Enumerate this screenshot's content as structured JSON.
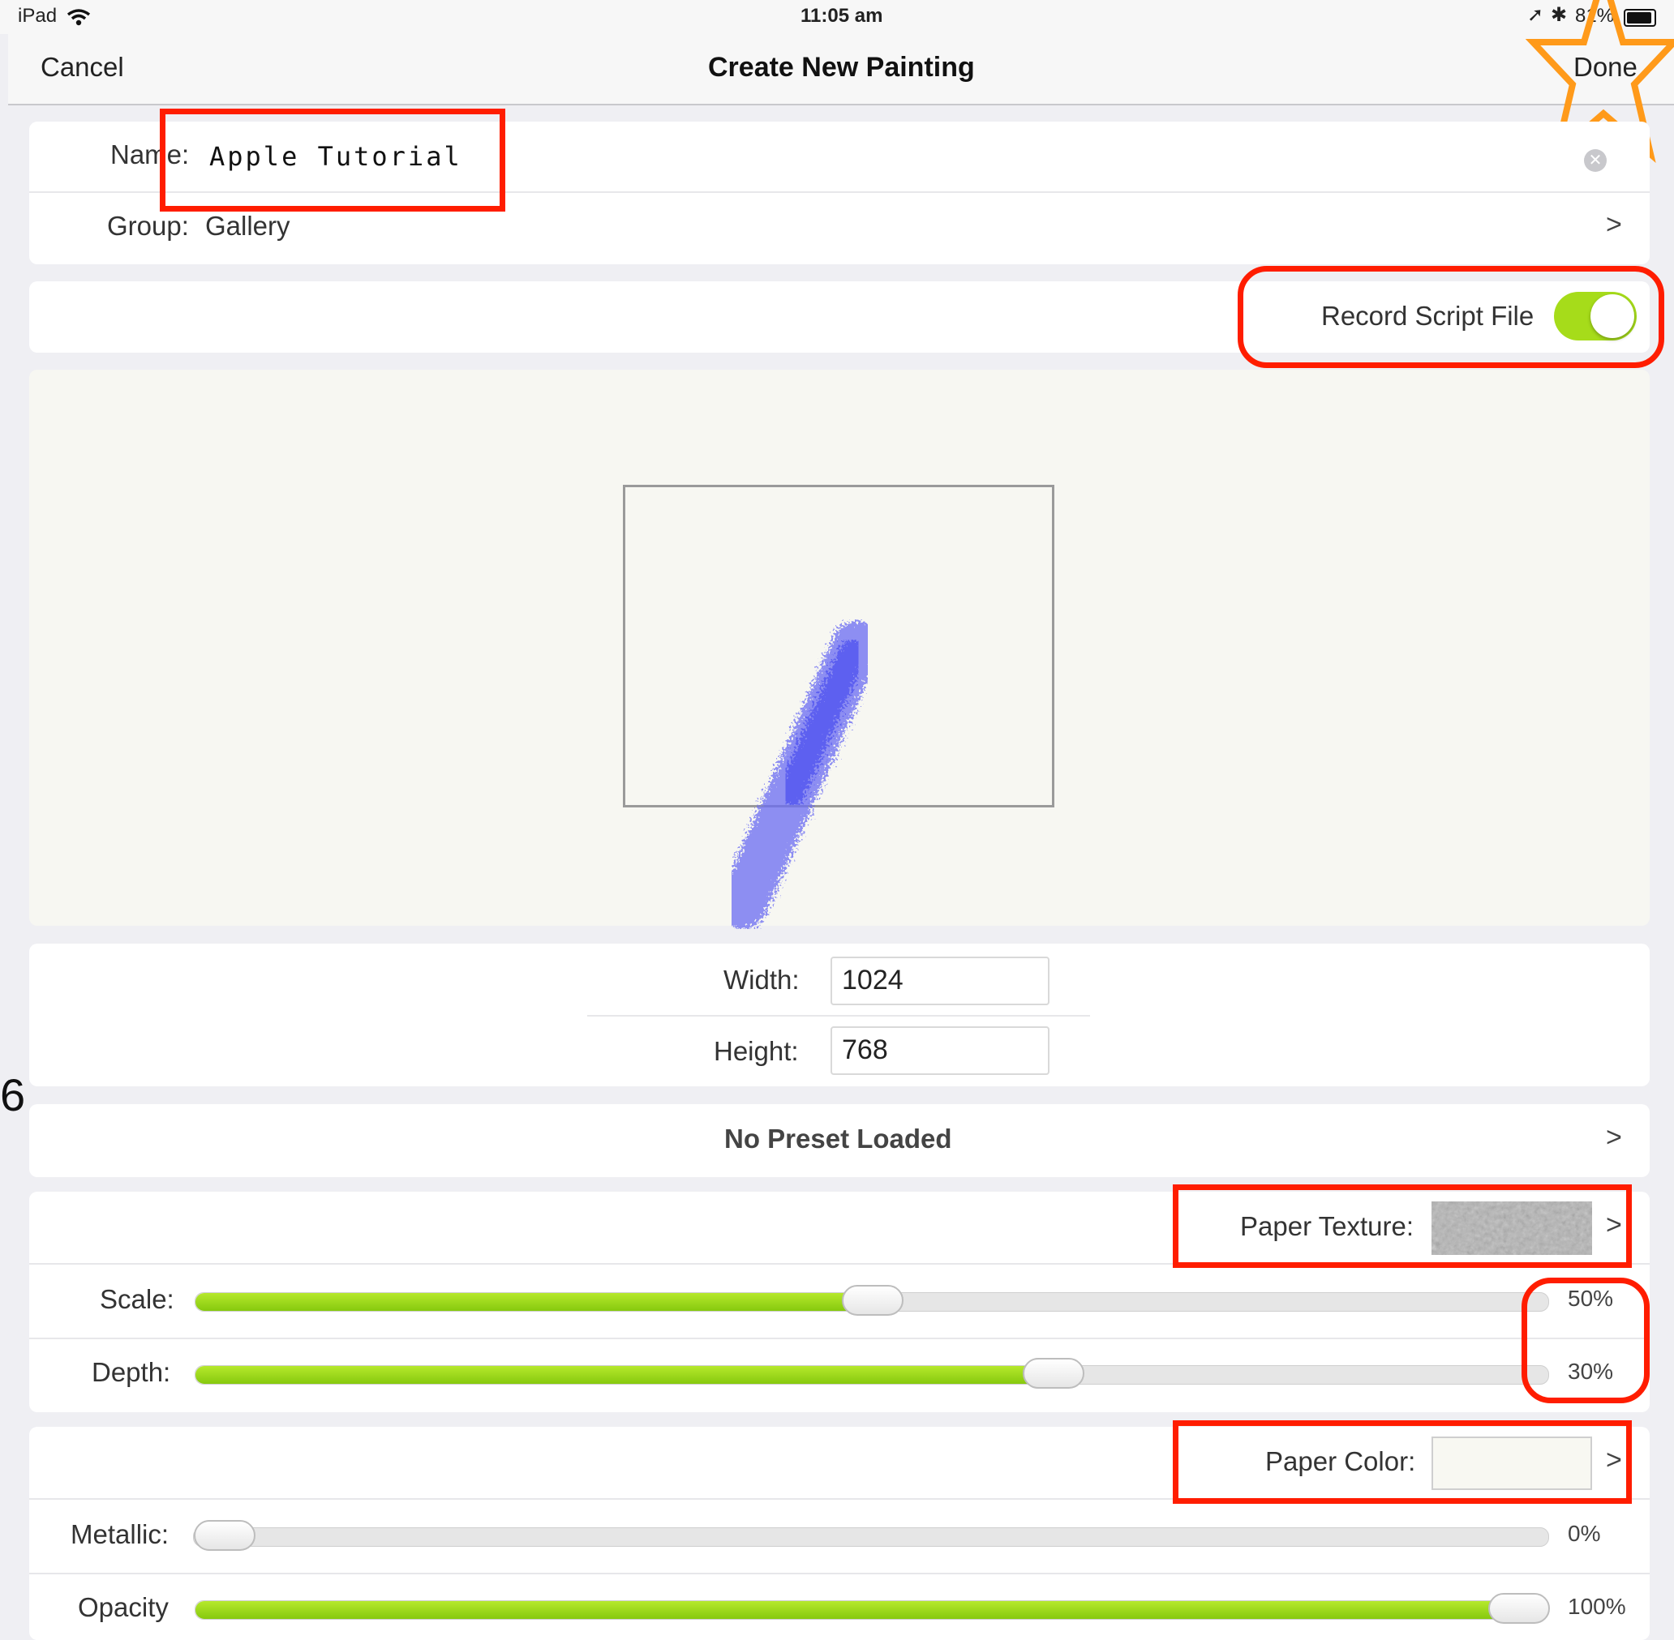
{
  "status_bar": {
    "device": "iPad",
    "time": "11:05 am",
    "battery": "81%",
    "icons": [
      "wifi-icon",
      "location-icon",
      "bluetooth-icon",
      "battery-icon"
    ]
  },
  "nav": {
    "cancel": "Cancel",
    "title": "Create New Painting",
    "done": "Done"
  },
  "name_row": {
    "label": "Name:",
    "value": "Apple Tutorial"
  },
  "group_row": {
    "label": "Group:",
    "value": "Gallery",
    "chevron": ">"
  },
  "record_row": {
    "label": "Record Script File",
    "on": true
  },
  "size": {
    "width_label": "Width:",
    "width_value": "1024",
    "height_label": "Height:",
    "height_value": "768"
  },
  "preset": {
    "label": "No Preset Loaded",
    "chevron": ">"
  },
  "paper_texture": {
    "label": "Paper Texture:",
    "chevron": ">"
  },
  "scale": {
    "label": "Scale:",
    "value": "50%",
    "fill": 0.5
  },
  "depth": {
    "label": "Depth:",
    "value": "30%",
    "fill": 0.64
  },
  "paper_color": {
    "label": "Paper Color:",
    "chevron": ">"
  },
  "metallic": {
    "label": "Metallic:",
    "value": "0%",
    "fill": 0.0
  },
  "opacity": {
    "label": "Opacity",
    "value": "100%",
    "fill": 1.0
  },
  "stray_glyph": "6",
  "colors": {
    "accent_green": "#9bd61c",
    "annotation_red": "#ff1d00",
    "annotation_orange": "#ff9a1a",
    "stroke_blue": "#5a5cf0"
  }
}
